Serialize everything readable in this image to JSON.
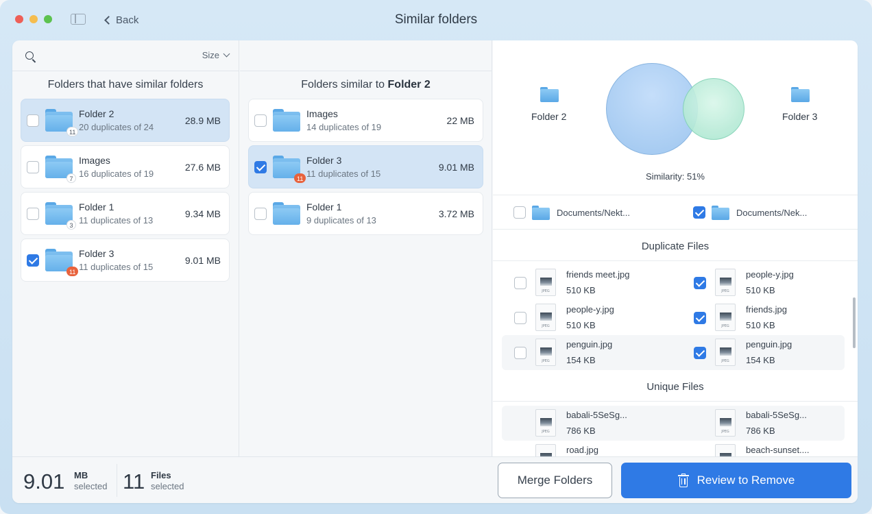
{
  "window": {
    "title": "Similar folders",
    "back_label": "Back"
  },
  "left_panel": {
    "sort_label": "Size",
    "header": "Folders that have similar folders",
    "folders": [
      {
        "name": "Folder 2",
        "sub": "20 duplicates of 24",
        "size": "28.9 MB",
        "badge": "11",
        "checked": false,
        "selected": true,
        "badge_style": "plain"
      },
      {
        "name": "Images",
        "sub": "16 duplicates of 19",
        "size": "27.6 MB",
        "badge": "7",
        "checked": false,
        "selected": false,
        "badge_style": "plain"
      },
      {
        "name": "Folder 1",
        "sub": "11 duplicates of 13",
        "size": "9.34 MB",
        "badge": "3",
        "checked": false,
        "selected": false,
        "badge_style": "plain"
      },
      {
        "name": "Folder 3",
        "sub": "11 duplicates of 15",
        "size": "9.01 MB",
        "badge": "11",
        "checked": true,
        "selected": false,
        "badge_style": "orange"
      }
    ]
  },
  "middle_panel": {
    "header_prefix": "Folders similar to",
    "header_folder": "Folder 2",
    "folders": [
      {
        "name": "Images",
        "sub": "14 duplicates of 19",
        "size": "22 MB",
        "checked": false,
        "selected": false,
        "badge": ""
      },
      {
        "name": "Folder 3",
        "sub": "11 duplicates of 15",
        "size": "9.01 MB",
        "checked": true,
        "selected": true,
        "badge": "11"
      },
      {
        "name": "Folder 1",
        "sub": "9 duplicates of 13",
        "size": "3.72 MB",
        "checked": false,
        "selected": false,
        "badge": ""
      }
    ]
  },
  "right_panel": {
    "venn_left_label": "Folder 2",
    "venn_right_label": "Folder 3",
    "similarity": "Similarity: 51%",
    "left_path": "Documents/Nekt...",
    "right_path": "Documents/Nek...",
    "left_path_checked": false,
    "right_path_checked": true,
    "duplicate_title": "Duplicate Files",
    "duplicates": [
      {
        "left_name": "friends meet.jpg",
        "left_size": "510 KB",
        "left_checked": false,
        "right_name": "people-y.jpg",
        "right_size": "510 KB",
        "right_checked": true
      },
      {
        "left_name": "people-y.jpg",
        "left_size": "510 KB",
        "left_checked": false,
        "right_name": "friends.jpg",
        "right_size": "510 KB",
        "right_checked": true
      },
      {
        "left_name": "penguin.jpg",
        "left_size": "154 KB",
        "left_checked": false,
        "right_name": "penguin.jpg",
        "right_size": "154 KB",
        "right_checked": true
      }
    ],
    "unique_title": "Unique Files",
    "uniques": [
      {
        "left_name": "babali-5SeSg...",
        "left_size": "786 KB",
        "right_name": "babali-5SeSg...",
        "right_size": "786 KB"
      },
      {
        "left_name": "road.jpg",
        "left_size": "",
        "right_name": "beach-sunset....",
        "right_size": ""
      }
    ]
  },
  "footer": {
    "size_value": "9.01",
    "size_unit": "MB",
    "size_label": "selected",
    "files_value": "11",
    "files_unit": "Files",
    "files_label": "selected",
    "merge_label": "Merge Folders",
    "review_label": "Review to Remove"
  },
  "colors": {
    "accent": "#2f7ae5",
    "badge_orange": "#e8623c",
    "folder_blue": "#65b0ea"
  }
}
